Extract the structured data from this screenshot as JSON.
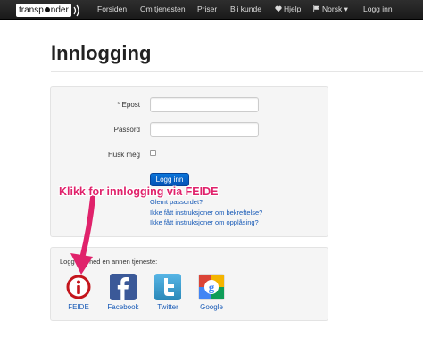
{
  "nav": {
    "logo": "transp",
    "logo_tail": "nder",
    "items": [
      {
        "label": "Forsiden"
      },
      {
        "label": "Om tjenesten"
      },
      {
        "label": "Priser"
      },
      {
        "label": "Bli kunde"
      },
      {
        "label": "Hjelp",
        "icon": "heart-icon"
      },
      {
        "label": "Norsk",
        "icon": "flag-icon",
        "caret": "▾"
      },
      {
        "label": "Logg inn"
      }
    ]
  },
  "page": {
    "title": "Innlogging"
  },
  "login_form": {
    "email_label": "* Epost",
    "email_value": "",
    "password_label": "Passord",
    "password_value": "",
    "remember_label": "Husk meg",
    "remember_checked": false,
    "submit_label": "Logg inn",
    "links": [
      "Glemt passordet?",
      "Ikke fått instruksjoner om bekreftelse?",
      "Ikke fått instruksjoner om opplåsing?"
    ]
  },
  "annotation": {
    "text": "Klikk for innlogging via FEIDE",
    "color": "#e0226b"
  },
  "other_login": {
    "label": "Logg inn med en annen tjeneste:",
    "providers": [
      {
        "label": "FEIDE",
        "icon": "feide-icon",
        "color": "#ffffff"
      },
      {
        "label": "Facebook",
        "icon": "facebook-icon",
        "color": "#3b5998"
      },
      {
        "label": "Twitter",
        "icon": "twitter-icon",
        "color": "#2a88b8"
      },
      {
        "label": "Google",
        "icon": "google-icon",
        "color": "#ffffff"
      }
    ]
  }
}
